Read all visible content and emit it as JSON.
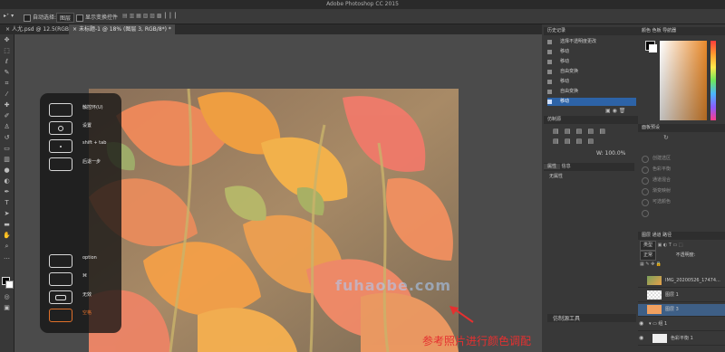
{
  "titlebar": {
    "title": "Adobe Photoshop CC 2015"
  },
  "options": {
    "auto_select": "自动选择:",
    "auto_select_value": "图层",
    "show_transform": "显示变换控件"
  },
  "tabs": [
    {
      "label": "人尤.psd @ 12.5(RGB/8*) *"
    },
    {
      "label": "未标题-1 @ 18% (图层 3, RGB/8*) *"
    }
  ],
  "overlay": {
    "items": [
      {
        "label": "触控环(U)"
      },
      {
        "label": "设置"
      },
      {
        "label": "shift + tab"
      },
      {
        "label": "后退一步"
      },
      {
        "label": "option"
      },
      {
        "label": "⌘"
      },
      {
        "label": "无效"
      },
      {
        "label": "空格"
      }
    ]
  },
  "watermark": "fuhaobe.com",
  "annotation": "参考照片进行颜色调配",
  "history": {
    "title": "历史记录",
    "items": [
      {
        "label": "选择不透明度更改"
      },
      {
        "label": "移动"
      },
      {
        "label": "移动"
      },
      {
        "label": "自由变换"
      },
      {
        "label": "移动"
      },
      {
        "label": "自由变换"
      },
      {
        "label": "移动"
      }
    ]
  },
  "align": {
    "title": "仿制源"
  },
  "zoom": {
    "label": "W: 100.0%"
  },
  "properties": {
    "tab_props": "属性",
    "tab_info": "信息",
    "no_props": "无属性"
  },
  "adjustments": {
    "title": "面板预设",
    "items": [
      {
        "label": "创建选区"
      },
      {
        "label": "色彩平衡"
      },
      {
        "label": "通道混合"
      },
      {
        "label": "渐变映射"
      },
      {
        "label": "可选颜色"
      }
    ]
  },
  "timeline": {
    "label": "仿制源工具"
  },
  "swatches": {
    "tabs": "颜色   色板   导航器"
  },
  "layers": {
    "tabs": "图层   通道   路径",
    "kind": "类型",
    "blend": "正常",
    "opacity_label": "不透明度:",
    "items": [
      {
        "name": "IMG_20200526_17474..."
      },
      {
        "name": "图层 1"
      },
      {
        "name": "图层 3"
      },
      {
        "name": "组 1"
      },
      {
        "name": "色彩平衡 1"
      }
    ]
  }
}
